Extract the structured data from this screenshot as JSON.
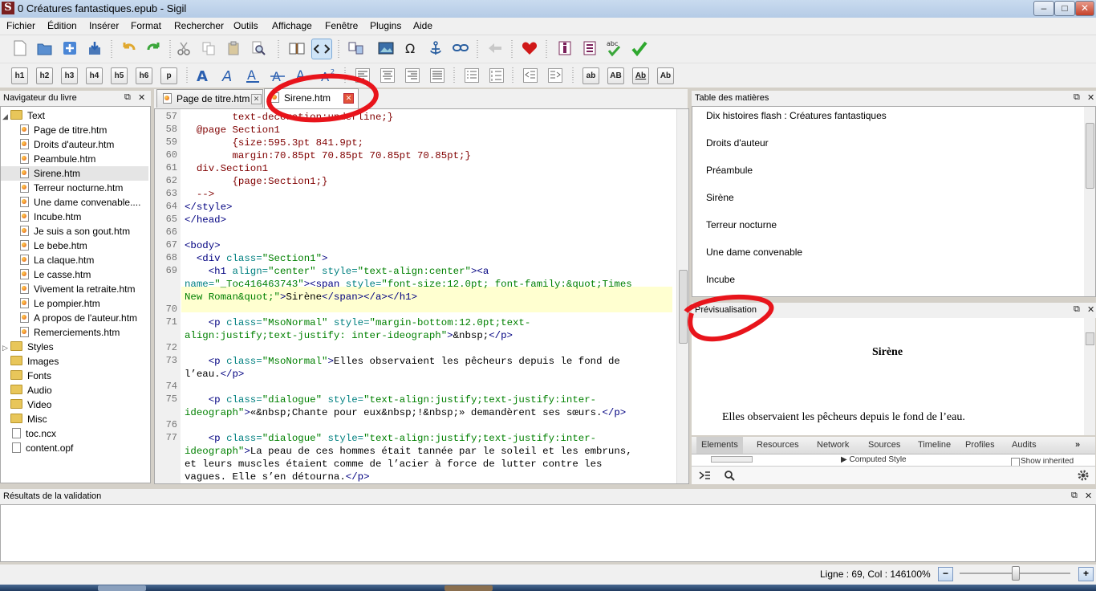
{
  "window": {
    "title": "0 Créatures fantastiques.epub - Sigil",
    "app_icon_letter": "S",
    "controls": [
      "–",
      "□",
      "✕"
    ]
  },
  "menu": [
    "Fichier",
    "Édition",
    "Insérer",
    "Format",
    "Rechercher",
    "Outils",
    "Affichage",
    "Fenêtre",
    "Plugins",
    "Aide"
  ],
  "toolbar": {
    "heading_buttons": [
      "h1",
      "h2",
      "h3",
      "h4",
      "h5",
      "h6",
      "p"
    ],
    "case_buttons": [
      "ab",
      "AB",
      "Ab",
      "Ab"
    ],
    "spellcheck_label": "abc"
  },
  "book_browser": {
    "title": "Navigateur du livre",
    "float_icon": "⧉",
    "close_icon": "✕",
    "text_folder": "Text",
    "text_files": [
      "Page de titre.htm",
      "Droits d'auteur.htm",
      "Peambule.htm",
      "Sirene.htm",
      "Terreur nocturne.htm",
      "Une dame convenable....",
      "Incube.htm",
      "Je suis a son gout.htm",
      "Le bebe.htm",
      "La claque.htm",
      "Le casse.htm",
      "Vivement la retraite.htm",
      "Le pompier.htm",
      "A propos de l'auteur.htm",
      "Remerciements.htm"
    ],
    "selected_file": "Sirene.htm",
    "folders": [
      "Styles",
      "Images",
      "Fonts",
      "Audio",
      "Video",
      "Misc"
    ],
    "root_files": [
      "toc.ncx",
      "content.opf"
    ]
  },
  "tabs": [
    {
      "label": "Page de titre.htm",
      "active": false
    },
    {
      "label": "Sirene.htm",
      "active": true
    }
  ],
  "editor": {
    "lines": [
      {
        "num": "57",
        "code": [
          [
            "css",
            "        text-decoration:underline;}"
          ]
        ]
      },
      {
        "num": "58",
        "code": [
          [
            "css",
            "  @page Section1"
          ]
        ]
      },
      {
        "num": "59",
        "code": [
          [
            "css",
            "        {size:595.3pt 841.9pt;"
          ]
        ]
      },
      {
        "num": "60",
        "code": [
          [
            "css",
            "        margin:70.85pt 70.85pt 70.85pt 70.85pt;}"
          ]
        ]
      },
      {
        "num": "61",
        "code": [
          [
            "css",
            "  div.Section1"
          ]
        ]
      },
      {
        "num": "62",
        "code": [
          [
            "css",
            "        {page:Section1;}"
          ]
        ]
      },
      {
        "num": "63",
        "code": [
          [
            "css",
            "  -->"
          ]
        ]
      },
      {
        "num": "64",
        "code": [
          [
            "tag",
            "</style>"
          ]
        ]
      },
      {
        "num": "65",
        "code": [
          [
            "tag",
            "</head>"
          ]
        ]
      },
      {
        "num": "66",
        "code": []
      },
      {
        "num": "67",
        "code": [
          [
            "tag",
            "<body>"
          ]
        ]
      },
      {
        "num": "68",
        "code": [
          [
            "tag",
            "  <div "
          ],
          [
            "attr",
            "class="
          ],
          [
            "val",
            "\"Section1\""
          ],
          [
            "tag",
            ">"
          ]
        ]
      },
      {
        "num": "69",
        "code": [
          [
            "tag",
            "    <h1 "
          ],
          [
            "attr",
            "align="
          ],
          [
            "val",
            "\"center\" "
          ],
          [
            "attr",
            "style="
          ],
          [
            "val",
            "\"text-align:center\""
          ],
          [
            "tag",
            "><a"
          ]
        ]
      },
      {
        "num": "",
        "code": [
          [
            "attr",
            "name="
          ],
          [
            "val",
            "\"_Toc416463743\""
          ],
          [
            "tag",
            "><span "
          ],
          [
            "attr",
            "style="
          ],
          [
            "val",
            "\"font-size:12.0pt; font-family:&quot;Times"
          ]
        ]
      },
      {
        "num": "",
        "code": [
          [
            "val",
            "New Roman&quot;\""
          ],
          [
            "tag",
            ">"
          ],
          [
            "plain",
            "Sirène"
          ],
          [
            "tag",
            "</span></a></h1>"
          ]
        ]
      },
      {
        "num": "70",
        "code": []
      },
      {
        "num": "71",
        "code": [
          [
            "tag",
            "    <p "
          ],
          [
            "attr",
            "class="
          ],
          [
            "val",
            "\"MsoNormal\" "
          ],
          [
            "attr",
            "style="
          ],
          [
            "val",
            "\"margin-bottom:12.0pt;text-"
          ]
        ]
      },
      {
        "num": "",
        "code": [
          [
            "val",
            "align:justify;text-justify: inter-ideograph\""
          ],
          [
            "tag",
            ">"
          ],
          [
            "plain",
            "&nbsp;"
          ],
          [
            "tag",
            "</p>"
          ]
        ]
      },
      {
        "num": "72",
        "code": []
      },
      {
        "num": "73",
        "code": [
          [
            "tag",
            "    <p "
          ],
          [
            "attr",
            "class="
          ],
          [
            "val",
            "\"MsoNormal\""
          ],
          [
            "tag",
            ">"
          ],
          [
            "plain",
            "Elles observaient les pêcheurs depuis le fond de"
          ]
        ]
      },
      {
        "num": "",
        "code": [
          [
            "plain",
            "l’eau."
          ],
          [
            "tag",
            "</p>"
          ]
        ]
      },
      {
        "num": "74",
        "code": []
      },
      {
        "num": "75",
        "code": [
          [
            "tag",
            "    <p "
          ],
          [
            "attr",
            "class="
          ],
          [
            "val",
            "\"dialogue\" "
          ],
          [
            "attr",
            "style="
          ],
          [
            "val",
            "\"text-align:justify;text-justify:inter-"
          ]
        ]
      },
      {
        "num": "",
        "code": [
          [
            "val",
            "ideograph\""
          ],
          [
            "tag",
            ">"
          ],
          [
            "plain",
            "«&nbsp;Chante pour eux&nbsp;!&nbsp;» demandèrent ses sœurs."
          ],
          [
            "tag",
            "</p>"
          ]
        ]
      },
      {
        "num": "76",
        "code": []
      },
      {
        "num": "77",
        "code": [
          [
            "tag",
            "    <p "
          ],
          [
            "attr",
            "class="
          ],
          [
            "val",
            "\"dialogue\" "
          ],
          [
            "attr",
            "style="
          ],
          [
            "val",
            "\"text-align:justify;text-justify:inter-"
          ]
        ]
      },
      {
        "num": "",
        "code": [
          [
            "val",
            "ideograph\""
          ],
          [
            "tag",
            ">"
          ],
          [
            "plain",
            "La peau de ces hommes était tannée par le soleil et les embruns,"
          ]
        ]
      },
      {
        "num": "",
        "code": [
          [
            "plain",
            "et leurs muscles étaient comme de l’acier à force de lutter contre les"
          ]
        ]
      },
      {
        "num": "",
        "code": [
          [
            "plain",
            "vagues. Elle s’en détourna."
          ],
          [
            "tag",
            "</p>"
          ]
        ]
      }
    ]
  },
  "toc": {
    "title": "Table des matières",
    "float_icon": "⧉",
    "close_icon": "✕",
    "items": [
      "Dix histoires flash : Créatures fantastiques",
      "Droits d'auteur",
      "Préambule",
      "Sirène",
      "Terreur nocturne",
      "Une dame convenable",
      "Incube"
    ]
  },
  "preview": {
    "title": "Prévisualisation",
    "float_icon": "⧉",
    "close_icon": "✕",
    "heading": "Sirène",
    "paragraph": "Elles observaient les pêcheurs depuis le fond de l’eau."
  },
  "devtools": {
    "tabs": [
      "Elements",
      "Resources",
      "Network",
      "Sources",
      "Timeline",
      "Profiles",
      "Audits"
    ],
    "more": "»",
    "computed_style": "Computed Style",
    "show_inherited": "Show inherited"
  },
  "validation": {
    "title": "Résultats de la validation",
    "float_icon": "⧉",
    "close_icon": "✕"
  },
  "status": {
    "position": "Ligne : 69, Col : 146",
    "zoom": "100%",
    "zoom_out": "−",
    "zoom_in": "+"
  },
  "colors": {
    "annotation": "#e8141b",
    "current_line": "#ffffd0",
    "code_tag": "#000080",
    "code_attr": "#008080",
    "code_value": "#008000"
  }
}
